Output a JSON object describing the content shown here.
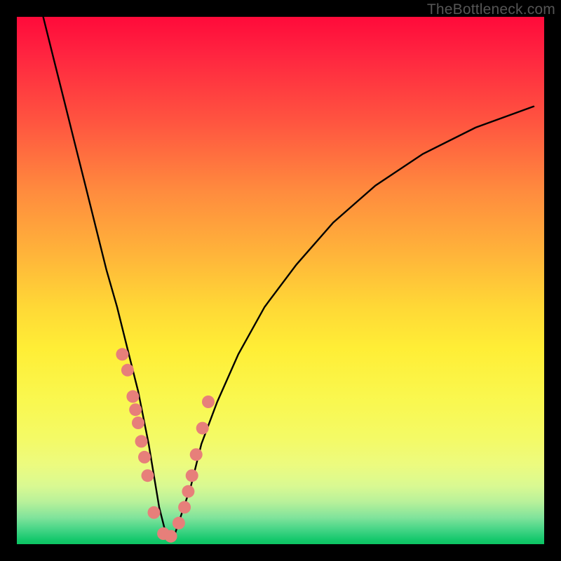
{
  "watermark": {
    "text": "TheBottleneck.com"
  },
  "chart_data": {
    "type": "line",
    "title": "",
    "xlabel": "",
    "ylabel": "",
    "xlim": [
      0,
      100
    ],
    "ylim": [
      0,
      100
    ],
    "grid": false,
    "legend": false,
    "series": [
      {
        "name": "bottleneck-curve",
        "x": [
          5,
          7,
          9,
          11,
          13,
          15,
          17,
          19,
          21,
          22,
          23,
          24,
          25,
          26,
          27,
          28,
          29,
          30,
          31,
          33,
          35,
          38,
          42,
          47,
          53,
          60,
          68,
          77,
          87,
          98
        ],
        "y": [
          100,
          92,
          84,
          76,
          68,
          60,
          52,
          45,
          37,
          33,
          29,
          24,
          19,
          13,
          7,
          3,
          1,
          2,
          5,
          11,
          19,
          27,
          36,
          45,
          53,
          61,
          68,
          74,
          79,
          83
        ]
      }
    ],
    "points": {
      "name": "data-points",
      "color": "#e77f7a",
      "radius_px": 9,
      "x": [
        20,
        21,
        22,
        22.5,
        23,
        23.6,
        24.2,
        24.8,
        26,
        27.8,
        29.2,
        30.7,
        31.8,
        32.5,
        33.2,
        34,
        35.2,
        36.3
      ],
      "y": [
        36,
        33,
        28,
        25.5,
        23,
        19.5,
        16.5,
        13,
        6,
        2,
        1.5,
        4,
        7,
        10,
        13,
        17,
        22,
        27
      ]
    },
    "background_gradient": {
      "orientation": "vertical",
      "stops": [
        {
          "pos": 0,
          "color": "#ff0a3a"
        },
        {
          "pos": 50,
          "color": "#ffc838"
        },
        {
          "pos": 80,
          "color": "#f5fa5e"
        },
        {
          "pos": 100,
          "color": "#0cc462"
        }
      ]
    }
  }
}
